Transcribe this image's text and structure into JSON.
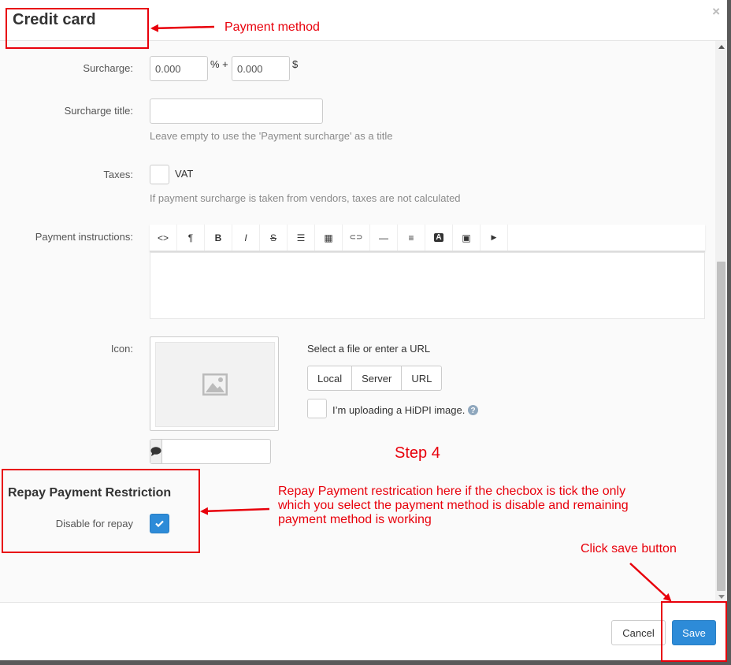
{
  "modal": {
    "title": "Credit card",
    "close_label": "×"
  },
  "form": {
    "surcharge": {
      "label": "Surcharge:",
      "percent_value": "0.000",
      "percent_unit": "% +",
      "absolute_value": "0.000",
      "currency": "$"
    },
    "surcharge_title": {
      "label": "Surcharge title:",
      "value": "",
      "hint": "Leave empty to use the 'Payment surcharge' as a title"
    },
    "taxes": {
      "label": "Taxes:",
      "option_label": "VAT",
      "checked": false,
      "hint": "If payment surcharge is taken from vendors, taxes are not calculated"
    },
    "payment_instructions": {
      "label": "Payment instructions:",
      "toolbar": [
        {
          "name": "code-view-icon",
          "glyph": "<>"
        },
        {
          "name": "paragraph-icon",
          "glyph": "¶"
        },
        {
          "name": "bold-icon",
          "glyph": "B"
        },
        {
          "name": "italic-icon",
          "glyph": "I"
        },
        {
          "name": "strikethrough-icon",
          "glyph": "S"
        },
        {
          "name": "list-icon",
          "glyph": "☰"
        },
        {
          "name": "table-icon",
          "glyph": "▦"
        },
        {
          "name": "link-icon",
          "glyph": "⊂⊃"
        },
        {
          "name": "horizontal-rule-icon",
          "glyph": "—"
        },
        {
          "name": "align-icon",
          "glyph": "≡"
        },
        {
          "name": "font-color-icon",
          "glyph": "A"
        },
        {
          "name": "image-icon",
          "glyph": "▣"
        },
        {
          "name": "video-icon",
          "glyph": "▶"
        }
      ],
      "content": ""
    },
    "icon": {
      "label": "Icon:",
      "select_text": "Select a file or enter a URL",
      "buttons": [
        "Local",
        "Server",
        "URL"
      ],
      "hidpi_label": "I’m uploading a HiDPI image.",
      "alt_value": ""
    }
  },
  "repay_section": {
    "title": "Repay Payment Restriction",
    "disable_label": "Disable for repay",
    "checked": true
  },
  "footer": {
    "cancel_label": "Cancel",
    "save_label": "Save"
  },
  "annotations": {
    "payment_method": "Payment method",
    "step": "Step 4",
    "repay_note_line1": "Repay Payment restrication here if the checbox is tick the only",
    "repay_note_line2": "which you select the payment method is disable and remaining",
    "repay_note_line3": "payment method is working",
    "save_note": "Click save button"
  },
  "colors": {
    "accent": "#2d8bd8",
    "annotation": "#e8000b"
  }
}
